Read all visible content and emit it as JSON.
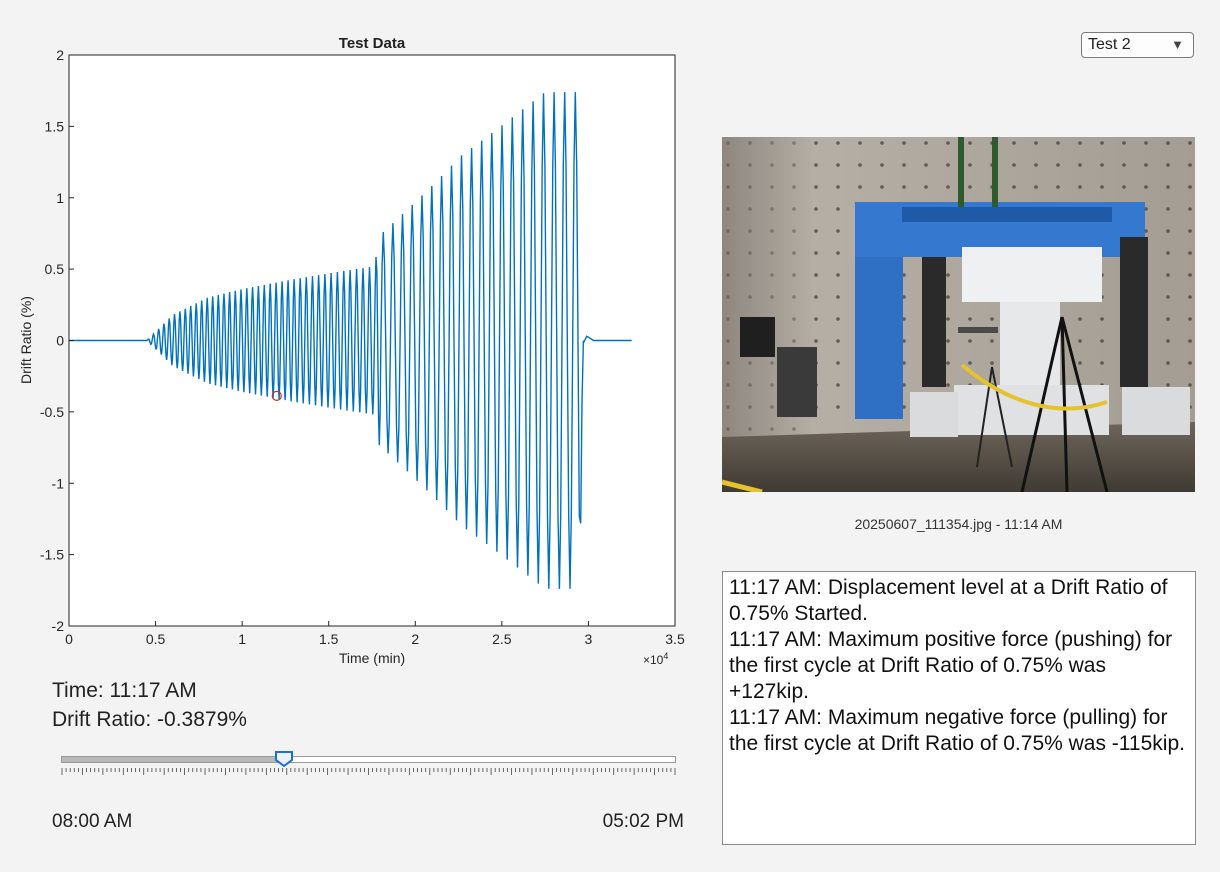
{
  "dropdown": {
    "selected": "Test 2"
  },
  "chart_data": {
    "type": "line",
    "title": "Test Data",
    "xlabel": "Time (min)",
    "ylabel": "Drift Ratio (%)",
    "x_exponent_label": "×10",
    "x_exponent_power": "4",
    "xlim": [
      0,
      35000
    ],
    "ylim": [
      -2,
      2
    ],
    "x_ticks": [
      0,
      5000,
      10000,
      15000,
      20000,
      25000,
      30000,
      35000
    ],
    "x_tick_labels": [
      "0",
      "0.5",
      "1",
      "1.5",
      "2",
      "2.5",
      "3",
      "3.5"
    ],
    "y_ticks": [
      2,
      1.5,
      1,
      0.5,
      0,
      -0.5,
      -1,
      -1.5,
      -2
    ],
    "y_tick_labels": [
      "2",
      "1.5",
      "1",
      "0.5",
      "0",
      "-0.5",
      "-1",
      "-1.5",
      "-2"
    ],
    "line_color": "#0072bd",
    "marker_color": "#c0392b",
    "marker": {
      "x": 12000,
      "y": -0.3879
    },
    "envelope": [
      {
        "x": 0,
        "y": 0
      },
      {
        "x": 4500,
        "y": 0
      },
      {
        "x": 6000,
        "y": 0.18
      },
      {
        "x": 8000,
        "y": 0.3
      },
      {
        "x": 10000,
        "y": 0.36
      },
      {
        "x": 13000,
        "y": 0.43
      },
      {
        "x": 16000,
        "y": 0.49
      },
      {
        "x": 17700,
        "y": 0.52
      },
      {
        "x": 17800,
        "y": 0.72
      },
      {
        "x": 19400,
        "y": 0.9
      },
      {
        "x": 21100,
        "y": 1.1
      },
      {
        "x": 22700,
        "y": 1.3
      },
      {
        "x": 24400,
        "y": 1.45
      },
      {
        "x": 26000,
        "y": 1.6
      },
      {
        "x": 27500,
        "y": 1.74
      },
      {
        "x": 29500,
        "y": 1.74
      },
      {
        "x": 29700,
        "y": 0
      },
      {
        "x": 32500,
        "y": 0
      }
    ]
  },
  "readout": {
    "time": "Time: 11:17 AM",
    "drift": "Drift Ratio: -0.3879%"
  },
  "slider": {
    "value_fraction": 0.363,
    "start_label": "08:00 AM",
    "end_label": "05:02 PM"
  },
  "photo": {
    "caption": "20250607_111354.jpg - 11:14 AM"
  },
  "log": {
    "lines": [
      "11:17 AM: Displacement level at a Drift Ratio of 0.75% Started.",
      "11:17 AM: Maximum positive force (pushing) for the first cycle at Drift Ratio of 0.75% was +127kip.",
      "11:17 AM: Maximum negative force (pulling) for the first cycle at Drift Ratio of 0.75% was -115kip."
    ]
  }
}
